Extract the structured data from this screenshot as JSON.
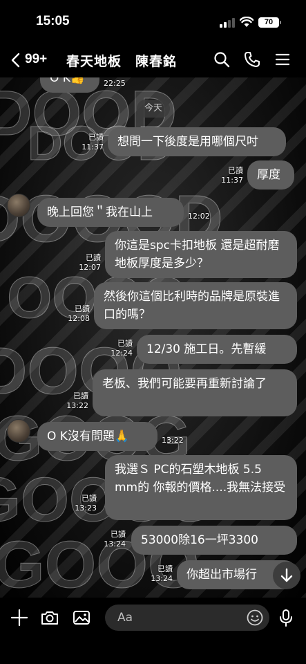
{
  "status": {
    "time": "15:05",
    "battery": "70"
  },
  "header": {
    "unread_count": "99+",
    "title": "春天地板　陳春銘"
  },
  "date_separator": "今天",
  "messages": [
    {
      "dir": "in",
      "text": "O K👍",
      "time": "22:25"
    },
    {
      "dir": "out",
      "text": "想問一下後度是用哪個尺吋",
      "read": "已讀",
      "time": "11:37"
    },
    {
      "dir": "out",
      "text": "厚度",
      "read": "已讀",
      "time": "11:37"
    },
    {
      "dir": "in",
      "text": "晚上回您＂我在山上",
      "time": "12:02"
    },
    {
      "dir": "out",
      "text": "你這是spc卡扣地板 還是超耐磨地板厚度是多少？",
      "read": "已讀",
      "time": "12:07"
    },
    {
      "dir": "out",
      "text": "然後你這個比利時的品牌是原裝進口的嗎？",
      "read": "已讀",
      "time": "12:08"
    },
    {
      "dir": "out",
      "text": "12/30 施工日。先暫緩",
      "read": "已讀",
      "time": "12:24"
    },
    {
      "dir": "out",
      "text": "老板、我們可能要再重新討論了",
      "read": "已讀",
      "time": "13:22"
    },
    {
      "dir": "in",
      "text": "O K沒有問題🙏",
      "time": "13:22"
    },
    {
      "dir": "out",
      "text": "我選Ｓ PC的石塑木地板 5.5 mm的 你報的價格....我無法接受",
      "read": "已讀",
      "time": "13:23"
    },
    {
      "dir": "out",
      "text": "53000除16一坪3300",
      "read": "已讀",
      "time": "13:24"
    },
    {
      "dir": "out",
      "text": "你超出市場行",
      "read": "已讀",
      "time": "13:24"
    }
  ],
  "input": {
    "placeholder": "Aa"
  },
  "icons": {
    "back": "chevron-left-icon",
    "search": "search-icon",
    "call": "phone-icon",
    "menu": "hamburger-menu-icon",
    "add": "plus-icon",
    "camera": "camera-icon",
    "gallery": "image-icon",
    "emoji": "emoji-icon",
    "mic": "microphone-icon",
    "scroll": "arrow-down-icon"
  },
  "colors": {
    "bubble": "#5d5d5d",
    "background": "#000000"
  }
}
